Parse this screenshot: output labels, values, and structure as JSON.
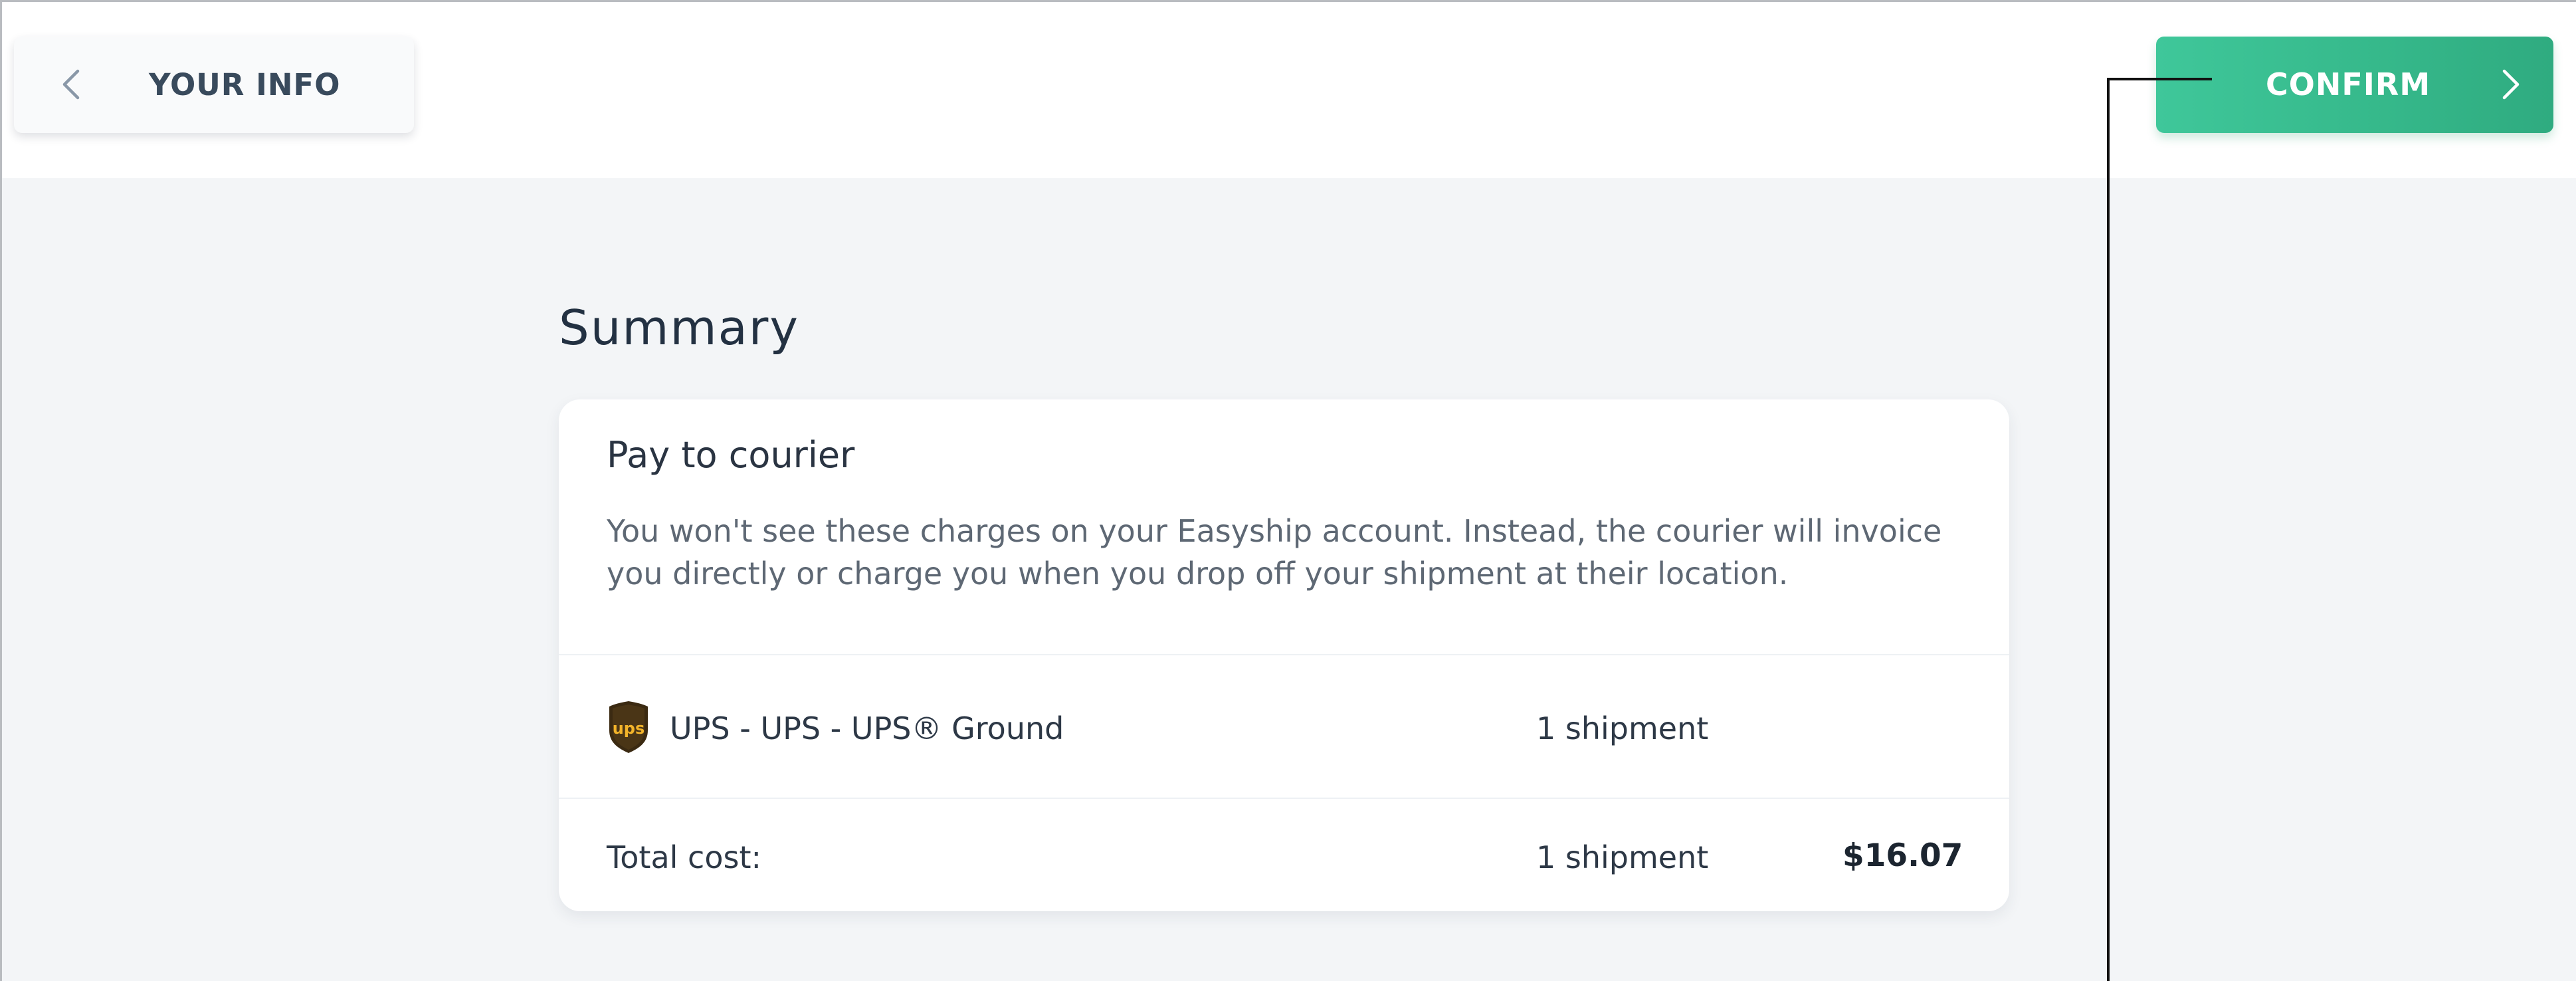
{
  "header": {
    "back_label": "YOUR INFO",
    "confirm_label": "CONFIRM",
    "back_icon": "chevron-left-icon",
    "confirm_icon": "chevron-right-icon"
  },
  "summary": {
    "title": "Summary",
    "section_title": "Pay to courier",
    "description": "You won't see these charges on your Easyship account. Instead, the courier will invoice you directly or charge you when you drop off your shipment at their location.",
    "courier": {
      "logo_icon": "ups-logo-icon",
      "logo_text": "ups",
      "service_name": "UPS - UPS - UPS® Ground",
      "shipments": "1 shipment"
    },
    "total": {
      "label": "Total cost:",
      "shipments": "1 shipment",
      "amount": "$16.07"
    }
  },
  "colors": {
    "accent": "#3bbf91",
    "page_bg": "#f3f5f7",
    "card_bg": "#ffffff"
  }
}
